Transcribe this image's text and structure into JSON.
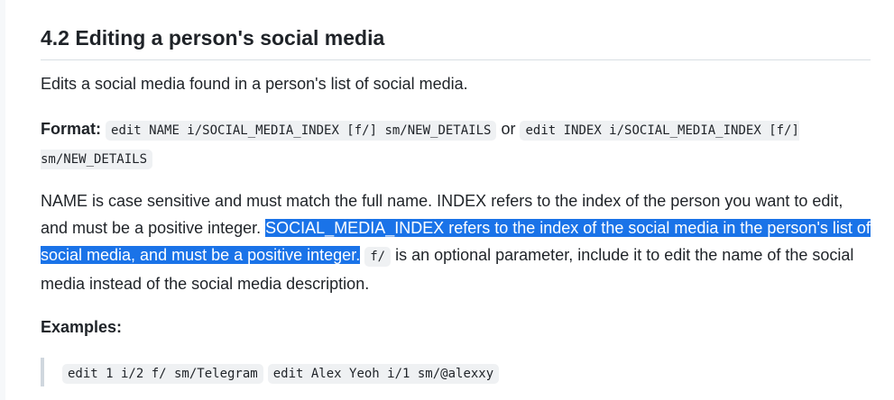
{
  "section": {
    "title": "4.2 Editing a person's social media"
  },
  "intro": "Edits a social media found in a person's list of social media.",
  "format": {
    "label": "Format:",
    "command_a": "edit NAME i/SOCIAL_MEDIA_INDEX [f/] sm/NEW_DETAILS",
    "or_text": " or ",
    "command_b": "edit INDEX i/SOCIAL_MEDIA_INDEX [f/] sm/NEW_DETAILS"
  },
  "description": {
    "part1": "NAME is case sensitive and must match the full name. INDEX refers to the index of the person you want to edit, and must be a positive integer. ",
    "highlighted": "SOCIAL_MEDIA_INDEX refers to the index of the social media in the person's list of social media, and must be a positive integer.",
    "code_flag": "f/",
    "part2": " is an optional parameter, include it to edit the name of the social media instead of the social media description."
  },
  "examples": {
    "label": "Examples:",
    "items": [
      "edit 1 i/2 f/ sm/Telegram",
      "edit Alex Yeoh i/1 sm/@alexxy"
    ]
  },
  "colors": {
    "selection_highlight": "#1a73e8",
    "code_background": "#eff1f3",
    "blockquote_border": "#d0d7de"
  }
}
